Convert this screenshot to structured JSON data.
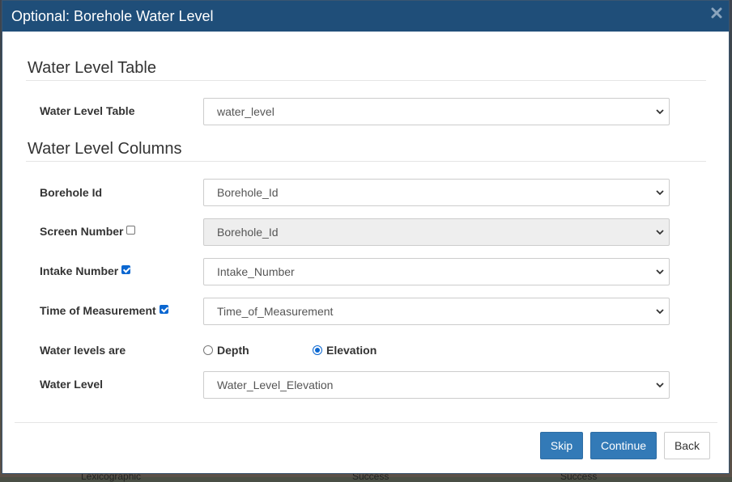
{
  "background": {
    "words": [
      "Lexicographic",
      "Success",
      "Success"
    ]
  },
  "dialog": {
    "title": "Optional: Borehole Water Level",
    "close_icon": "close-icon"
  },
  "sections": {
    "table_title": "Water Level Table",
    "columns_title": "Water Level Columns"
  },
  "fields": {
    "water_level_table": {
      "label": "Water Level Table",
      "value": "water_level"
    },
    "borehole_id": {
      "label": "Borehole Id",
      "value": "Borehole_Id"
    },
    "screen_number": {
      "label": "Screen Number",
      "checked": false,
      "value": "Borehole_Id",
      "disabled": true
    },
    "intake_number": {
      "label": "Intake Number",
      "checked": true,
      "value": "Intake_Number"
    },
    "time_of_measurement": {
      "label": "Time of Measurement",
      "checked": true,
      "value": "Time_of_Measurement"
    },
    "water_levels_are": {
      "label": "Water levels are",
      "options": [
        "Depth",
        "Elevation"
      ],
      "selected": "Elevation"
    },
    "water_level": {
      "label": "Water Level",
      "value": "Water_Level_Elevation"
    }
  },
  "buttons": {
    "skip": "Skip",
    "continue": "Continue",
    "back": "Back"
  },
  "colors": {
    "header": "#1f4e79",
    "primary": "#337ab7",
    "checkbox_accent": "#0b67d1"
  }
}
